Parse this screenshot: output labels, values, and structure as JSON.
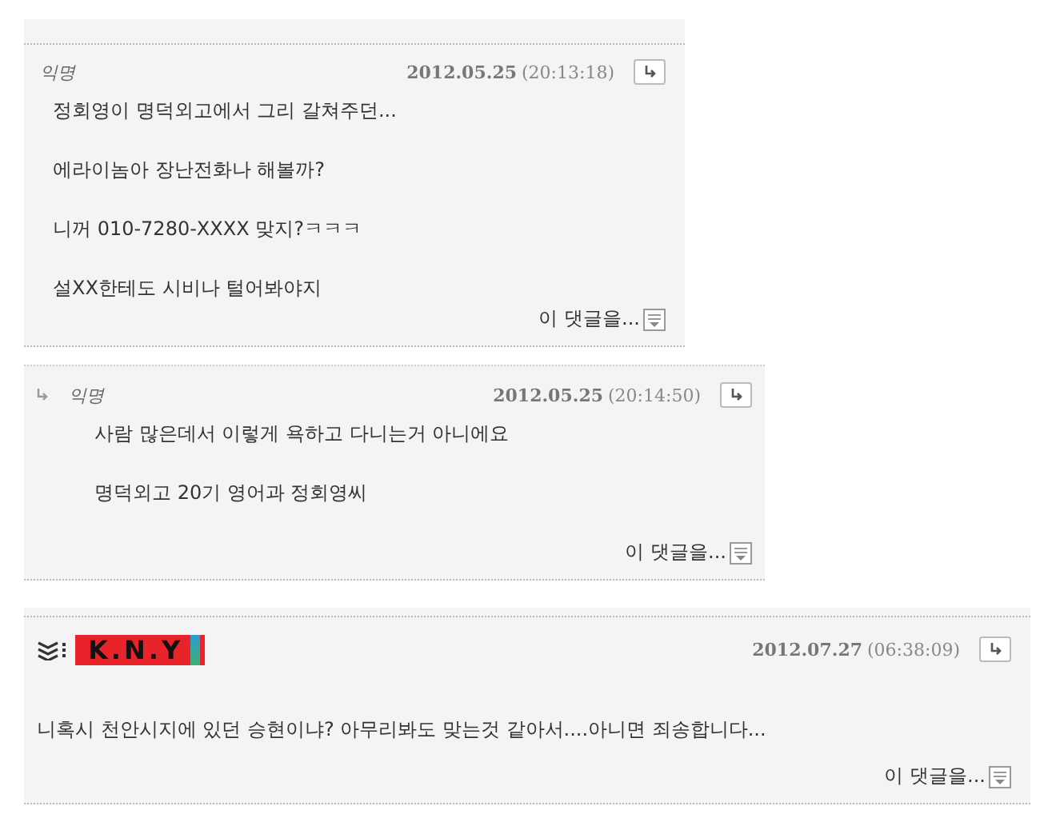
{
  "comments": [
    {
      "kind": "comment",
      "author": "익명",
      "date": "2012.05.25",
      "time": "(20:13:18)",
      "lines": [
        "정회영이 명덕외고에서 그리 갈쳐주던...",
        "에라이놈아 장난전화나 해볼까?",
        "니꺼 010-7280-XXXX 맞지?ㅋㅋㅋ",
        "설XX한테도 시비나 털어봐야지"
      ],
      "more": "이 댓글을..."
    },
    {
      "kind": "reply",
      "author": "익명",
      "date": "2012.05.25",
      "time": "(20:14:50)",
      "lines": [
        "사람 많은데서 이렇게 욕하고 다니는거 아니에요",
        "명덕외고 20기 영어과 정회영씨"
      ],
      "more": "이 댓글을..."
    },
    {
      "kind": "member",
      "author": "K.N.Y",
      "date": "2012.07.27",
      "time": "(06:38:09)",
      "lines": [
        "니혹시 천안시지에 있던 승현이냐? 아무리봐도 맞는것 같아서....아니면 죄송합니다..."
      ],
      "more": "이 댓글을..."
    }
  ]
}
